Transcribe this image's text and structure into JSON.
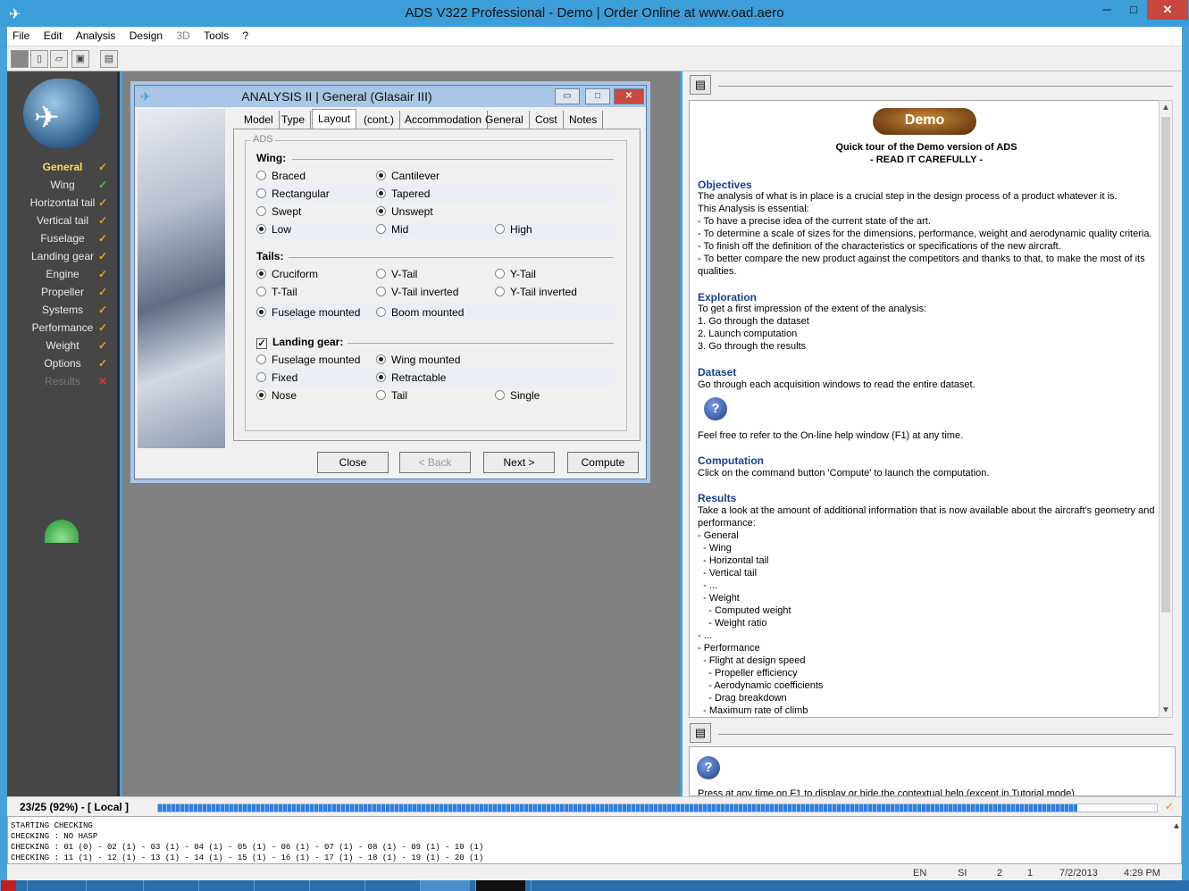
{
  "window": {
    "title": "ADS V322 Professional - Demo  |  Order Online at www.oad.aero",
    "minimize": "─",
    "maximize": "□",
    "close": "✕"
  },
  "menu": [
    "File",
    "Edit",
    "Analysis",
    "Design",
    "3D",
    "Tools",
    "?"
  ],
  "nav": [
    {
      "label": "General",
      "state": "active"
    },
    {
      "label": "Wing",
      "state": "done-green"
    },
    {
      "label": "Horizontal tail",
      "state": "done"
    },
    {
      "label": "Vertical tail",
      "state": "done"
    },
    {
      "label": "Fuselage",
      "state": "done"
    },
    {
      "label": "Landing gear",
      "state": "done"
    },
    {
      "label": "Engine",
      "state": "done"
    },
    {
      "label": "Propeller",
      "state": "done"
    },
    {
      "label": "Systems",
      "state": "done"
    },
    {
      "label": "Performance",
      "state": "done"
    },
    {
      "label": "Weight",
      "state": "done"
    },
    {
      "label": "Options",
      "state": "done"
    },
    {
      "label": "Results",
      "state": "disabled"
    }
  ],
  "dialog": {
    "title": "ANALYSIS II | General (Glasair III)",
    "tabs": [
      "Model",
      "Type",
      "Layout",
      "(cont.)",
      "Accommodation",
      "General",
      "Cost",
      "Notes"
    ],
    "selected_tab": "Layout",
    "group_title": "ADS",
    "wing": {
      "label": "Wing:",
      "options": {
        "braced": "Braced",
        "cantilever": "Cantilever",
        "rectangular": "Rectangular",
        "tapered": "Tapered",
        "swept": "Swept",
        "unswept": "Unswept",
        "low": "Low",
        "mid": "Mid",
        "high": "High"
      },
      "selected": [
        "Cantilever",
        "Tapered",
        "Unswept",
        "Low"
      ]
    },
    "tails": {
      "label": "Tails:",
      "options": {
        "cruciform": "Cruciform",
        "vtail": "V-Tail",
        "ytail": "Y-Tail",
        "ttail": "T-Tail",
        "vtail_inv": "V-Tail inverted",
        "ytail_inv": "Y-Tail inverted",
        "fuselage_mounted": "Fuselage mounted",
        "boom_mounted": "Boom mounted"
      },
      "selected": [
        "Cruciform",
        "Fuselage mounted"
      ]
    },
    "landing_gear": {
      "label": "Landing gear:",
      "checked": true,
      "options": {
        "fuselage_mounted": "Fuselage mounted",
        "wing_mounted": "Wing mounted",
        "fixed": "Fixed",
        "retractable": "Retractable",
        "nose": "Nose",
        "tail": "Tail",
        "single": "Single"
      },
      "selected": [
        "Wing mounted",
        "Retractable",
        "Nose"
      ]
    },
    "buttons": {
      "close": "Close",
      "back": "< Back",
      "next": "Next >",
      "compute": "Compute"
    }
  },
  "help": {
    "badge": "Demo",
    "title": "Quick tour of the Demo version of ADS",
    "subtitle": "- READ IT CAREFULLY -",
    "objectives_h": "Objectives",
    "objectives": [
      "The analysis of what is in place is a crucial step in the design process of a product whatever it is.",
      "This Analysis is essential:",
      "- To have a precise idea of the current state of the art.",
      "- To determine a scale of sizes for the dimensions, performance, weight and aerodynamic quality criteria.",
      "- To finish off the definition of the characteristics or specifications of the new aircraft.",
      "- To better compare the new product against the competitors and thanks to that, to make the most of its",
      "qualities."
    ],
    "exploration_h": "Exploration",
    "exploration": [
      "To get a first impression of the extent of the analysis:",
      "1. Go through the dataset",
      "2. Launch computation",
      "3. Go through the results"
    ],
    "dataset_h": "Dataset",
    "dataset": "Go through each acquisition windows to read the entire dataset.",
    "help_note": "Feel free to refer to the On-line help window (F1) at any time.",
    "computation_h": "Computation",
    "computation": "Click on the command button 'Compute' to launch the computation.",
    "results_h": "Results",
    "results": [
      "Take a look at the amount of additional information that is now available about the aircraft's geometry and",
      "performance:",
      "- General",
      "  - Wing",
      "  - Horizontal tail",
      "  - Vertical tail",
      "  - ...",
      "  - Weight",
      "    - Computed weight",
      "    - Weight ratio",
      "- ...",
      "- Performance",
      "  - Flight at design speed",
      "    - Propeller efficiency",
      "    - Aerodynamic coefficients",
      "    - Drag breakdown",
      "  - Maximum rate of climb"
    ],
    "context_text": "Press at any time on F1 to display or hide the contextual help (except in Tutorial mode)"
  },
  "progress": {
    "label": "23/25  (92%) - [ Local ]",
    "fraction": 0.92
  },
  "log": [
    "STARTING CHECKING",
    "CHECKING : NO HASP",
    "CHECKING : 01 (0) - 02 (1) - 03 (1) - 04 (1) - 05 (1) - 06 (1) - 07 (1) - 08 (1) - 09 (1) - 10 (1)",
    "CHECKING : 11 (1) - 12 (1) - 13 (1) - 14 (1) - 15 (1) - 16 (1) - 17 (1) - 18 (1) - 19 (1) - 20 (1)"
  ],
  "status": {
    "lang": "EN",
    "units": "SI",
    "a": "2",
    "b": "1",
    "date": "7/2/2013",
    "time": "4:29 PM"
  },
  "icons": {
    "app": "plane-icon",
    "print": "printer-icon",
    "help": "question-icon"
  }
}
